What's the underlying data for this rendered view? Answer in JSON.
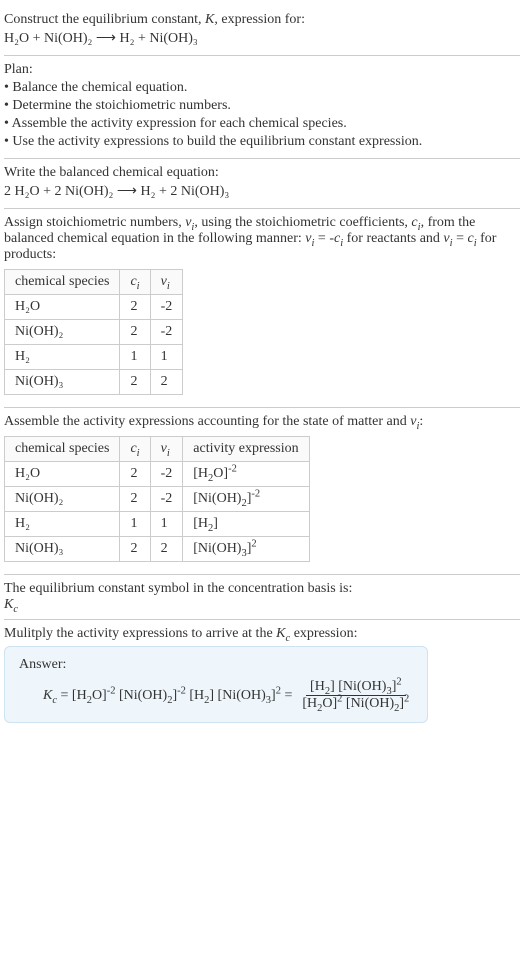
{
  "prompt": {
    "line1": "Construct the equilibrium constant, K, expression for:",
    "equation": "H₂O + Ni(OH)₂ ⟶ H₂ + Ni(OH)₃"
  },
  "plan": {
    "heading": "Plan:",
    "items": [
      "• Balance the chemical equation.",
      "• Determine the stoichiometric numbers.",
      "• Assemble the activity expression for each chemical species.",
      "• Use the activity expressions to build the equilibrium constant expression."
    ]
  },
  "balanced": {
    "heading": "Write the balanced chemical equation:",
    "equation": "2 H₂O + 2 Ni(OH)₂ ⟶ H₂ + 2 Ni(OH)₃"
  },
  "stoich": {
    "intro": "Assign stoichiometric numbers, νᵢ, using the stoichiometric coefficients, cᵢ, from the balanced chemical equation in the following manner: νᵢ = -cᵢ for reactants and νᵢ = cᵢ for products:",
    "headers": {
      "species": "chemical species",
      "ci": "cᵢ",
      "vi": "νᵢ"
    },
    "rows": [
      {
        "species": "H₂O",
        "ci": "2",
        "vi": "-2"
      },
      {
        "species": "Ni(OH)₂",
        "ci": "2",
        "vi": "-2"
      },
      {
        "species": "H₂",
        "ci": "1",
        "vi": "1"
      },
      {
        "species": "Ni(OH)₃",
        "ci": "2",
        "vi": "2"
      }
    ]
  },
  "activity": {
    "intro": "Assemble the activity expressions accounting for the state of matter and νᵢ:",
    "headers": {
      "species": "chemical species",
      "ci": "cᵢ",
      "vi": "νᵢ",
      "expr": "activity expression"
    },
    "rows": [
      {
        "species": "H₂O",
        "ci": "2",
        "vi": "-2",
        "expr": "[H₂O]⁻²"
      },
      {
        "species": "Ni(OH)₂",
        "ci": "2",
        "vi": "-2",
        "expr": "[Ni(OH)₂]⁻²"
      },
      {
        "species": "H₂",
        "ci": "1",
        "vi": "1",
        "expr": "[H₂]"
      },
      {
        "species": "Ni(OH)₃",
        "ci": "2",
        "vi": "2",
        "expr": "[Ni(OH)₃]²"
      }
    ]
  },
  "symbol": {
    "line1": "The equilibrium constant symbol in the concentration basis is:",
    "line2": "K_c"
  },
  "multiply": {
    "heading": "Mulitply the activity expressions to arrive at the K_c expression:"
  },
  "answer": {
    "label": "Answer:",
    "kc_lhs": "K_c = [H₂O]⁻² [Ni(OH)₂]⁻² [H₂] [Ni(OH)₃]² =",
    "frac_top": "[H₂] [Ni(OH)₃]²",
    "frac_bottom": "[H₂O]² [Ni(OH)₂]²"
  }
}
